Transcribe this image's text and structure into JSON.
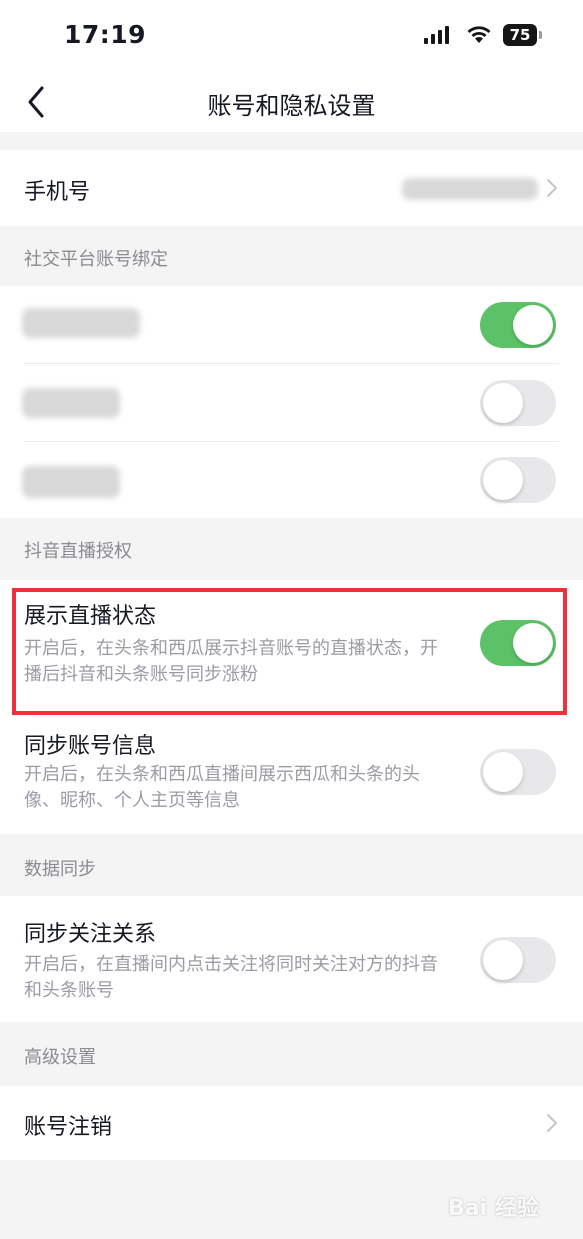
{
  "status_bar": {
    "time": "17:19",
    "battery": "75",
    "signal_icon": "cellular-signal-icon",
    "wifi_icon": "wifi-icon"
  },
  "nav": {
    "title": "账号和隐私设置",
    "back_icon": "chevron-left-icon"
  },
  "phone": {
    "label": "手机号"
  },
  "social_section": {
    "header": "社交平台账号绑定",
    "accounts": [
      {
        "enabled": true
      },
      {
        "enabled": false
      },
      {
        "enabled": false
      }
    ]
  },
  "live_section": {
    "header": "抖音直播授权",
    "items": [
      {
        "label": "展示直播状态",
        "desc": "开启后，在头条和西瓜展示抖音账号的直播状态，开播后抖音和头条账号同步涨粉",
        "enabled": true
      },
      {
        "label": "同步账号信息",
        "desc": "开启后，在头条和西瓜直播间展示西瓜和头条的头像、昵称、个人主页等信息",
        "enabled": false
      }
    ]
  },
  "data_section": {
    "header": "数据同步",
    "items": [
      {
        "label": "同步关注关系",
        "desc": "开启后，在直播间内点击关注将同时关注对方的抖音和头条账号",
        "enabled": false
      }
    ]
  },
  "advanced_section": {
    "header": "高级设置",
    "items": [
      {
        "label": "账号注销"
      }
    ]
  },
  "colors": {
    "toggle_on": "#5cc267",
    "toggle_off": "#e8e8ea",
    "highlight": "#f0303a"
  },
  "watermark": {
    "text": "Bai 经验"
  }
}
